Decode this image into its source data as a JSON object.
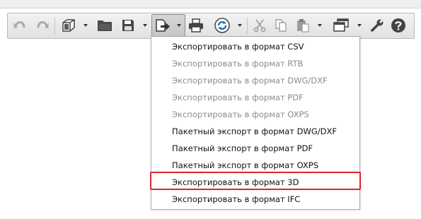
{
  "toolbar": {
    "icons": [
      {
        "name": "undo-icon",
        "enabled": false
      },
      {
        "name": "redo-icon",
        "enabled": false
      },
      {
        "name": "3d-view-icon",
        "has_dropdown": true
      },
      {
        "name": "open-folder-icon"
      },
      {
        "name": "save-icon",
        "has_dropdown": true
      },
      {
        "name": "export-icon",
        "has_dropdown": true,
        "pressed": true
      },
      {
        "name": "print-icon"
      },
      {
        "name": "refresh-icon",
        "has_dropdown": true
      },
      {
        "name": "cut-icon",
        "enabled": false
      },
      {
        "name": "copy-icon",
        "enabled": false
      },
      {
        "name": "paste-icon",
        "has_dropdown": true,
        "enabled": false
      },
      {
        "name": "windows-icon",
        "has_dropdown": true
      },
      {
        "name": "settings-wrench-icon"
      },
      {
        "name": "help-icon"
      }
    ]
  },
  "export_menu": {
    "items": [
      {
        "label": "Экспортировать в формат CSV",
        "enabled": true
      },
      {
        "label": "Экспортировать в формат RTB",
        "enabled": false
      },
      {
        "label": "Экспортировать в формат DWG/DXF",
        "enabled": false
      },
      {
        "label": "Экспортировать в формат PDF",
        "enabled": false
      },
      {
        "label": "Экспортировать в формат OXPS",
        "enabled": false
      },
      {
        "label": "Пакетный экспорт в формат DWG/DXF",
        "enabled": true
      },
      {
        "label": "Пакетный экспорт в формат PDF",
        "enabled": true
      },
      {
        "label": "Пакетный экспорт в формат OXPS",
        "enabled": true
      },
      {
        "label": "Экспортировать в формат 3D",
        "enabled": true,
        "highlighted": true
      },
      {
        "label": "Экспортировать в формат IFC",
        "enabled": true
      }
    ]
  },
  "colors": {
    "highlight_border": "#e0222d",
    "disabled_text": "#8c8c8c",
    "enabled_text": "#111111",
    "icon_blue": "#2f6fb5"
  }
}
